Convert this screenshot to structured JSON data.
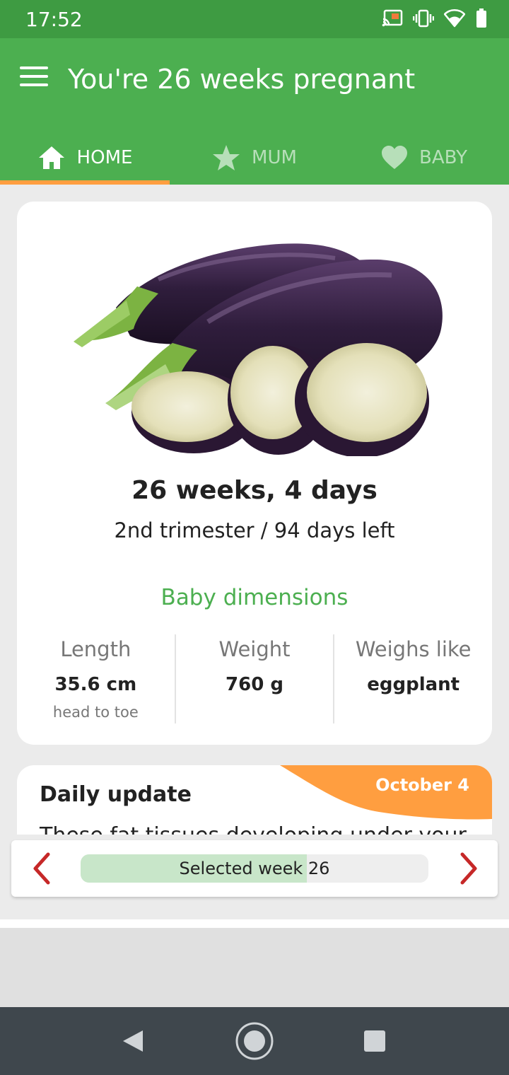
{
  "status_bar": {
    "time": "17:52"
  },
  "app_bar": {
    "title": "You're 26 weeks pregnant"
  },
  "tabs": [
    {
      "label": "HOME",
      "icon": "home-icon",
      "active": true
    },
    {
      "label": "MUM",
      "icon": "star-icon",
      "active": false
    },
    {
      "label": "BABY",
      "icon": "heart-icon",
      "active": false
    }
  ],
  "week_card": {
    "image": "eggplant",
    "headline": "26 weeks, 4 days",
    "trimester": "2nd trimester / 94 days left",
    "dimensions_title": "Baby dimensions",
    "dimensions": [
      {
        "label": "Length",
        "value": "35.6 cm",
        "sub": "head to toe"
      },
      {
        "label": "Weight",
        "value": "760 g",
        "sub": ""
      },
      {
        "label": "Weighs like",
        "value": "eggplant",
        "sub": ""
      }
    ]
  },
  "daily_update": {
    "title": "Daily update",
    "date": "October 4",
    "snippet": "These fat tissues developing under your"
  },
  "week_selector": {
    "label": "Selected week 26",
    "progress_fraction": 0.65
  },
  "colors": {
    "status_bar": "#3e9b42",
    "primary": "#4caf50",
    "accent_orange": "#ff9e40",
    "arrow_red": "#c62828",
    "nav_bar": "#3f474d"
  }
}
